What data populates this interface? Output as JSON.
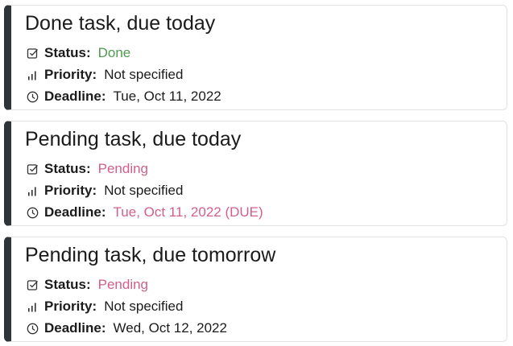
{
  "labels": {
    "status": "Status:",
    "priority": "Priority:",
    "deadline": "Deadline:"
  },
  "colors": {
    "done": "#4f9a4f",
    "pending": "#d0608a",
    "card_accent": "#2f3438"
  },
  "icons": {
    "status": "checkbox-icon",
    "priority": "bar-chart-icon",
    "deadline": "clock-icon"
  },
  "tasks": [
    {
      "title": "Done task, due today",
      "status": "Done",
      "status_kind": "done",
      "priority": "Not specified",
      "deadline": "Tue, Oct 11, 2022",
      "deadline_kind": "normal"
    },
    {
      "title": "Pending task, due today",
      "status": "Pending",
      "status_kind": "pending",
      "priority": "Not specified",
      "deadline": "Tue, Oct 11, 2022 (DUE)",
      "deadline_kind": "pending"
    },
    {
      "title": "Pending task, due tomorrow",
      "status": "Pending",
      "status_kind": "pending",
      "priority": "Not specified",
      "deadline": "Wed, Oct 12, 2022",
      "deadline_kind": "normal"
    }
  ]
}
